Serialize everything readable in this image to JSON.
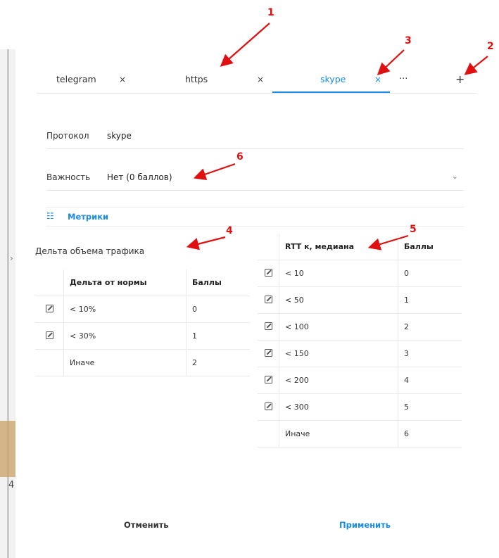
{
  "tabs": [
    {
      "label": "telegram",
      "close": "×",
      "active": false
    },
    {
      "label": "https",
      "close": "×",
      "active": false
    },
    {
      "label": "skype",
      "close": "×",
      "active": true
    }
  ],
  "tab_more": "···",
  "tab_add": "+",
  "form": {
    "protocol_label": "Протокол",
    "protocol_value": "skype",
    "importance_label": "Важность",
    "importance_value": "Нет (0 баллов)",
    "importance_chevron": "chevron-down-icon"
  },
  "metrics": {
    "icon": "list-icon",
    "label": "Метрики"
  },
  "traffic": {
    "title": "Дельта объема трафика",
    "headers": [
      "Дельта от нормы",
      "Баллы"
    ],
    "rows": [
      {
        "edit": true,
        "cond": "< 10%",
        "points": "0"
      },
      {
        "edit": true,
        "cond": "< 30%",
        "points": "1"
      },
      {
        "edit": false,
        "cond": "Иначе",
        "points": "2"
      }
    ]
  },
  "rtt": {
    "headers": [
      "RTT к, медиана",
      "Баллы"
    ],
    "rows": [
      {
        "edit": true,
        "cond": "< 10",
        "points": "0"
      },
      {
        "edit": true,
        "cond": "< 50",
        "points": "1"
      },
      {
        "edit": true,
        "cond": "< 100",
        "points": "2"
      },
      {
        "edit": true,
        "cond": "< 150",
        "points": "3"
      },
      {
        "edit": true,
        "cond": "< 200",
        "points": "4"
      },
      {
        "edit": true,
        "cond": "< 300",
        "points": "5"
      },
      {
        "edit": false,
        "cond": "Иначе",
        "points": "6"
      }
    ]
  },
  "buttons": {
    "cancel": "Отменить",
    "apply": "Применить"
  },
  "annotations": [
    "1",
    "2",
    "3",
    "4",
    "5",
    "6"
  ],
  "background": {
    "number": "4"
  },
  "colors": {
    "accent": "#1a8be6",
    "annotation": "#e01010"
  }
}
